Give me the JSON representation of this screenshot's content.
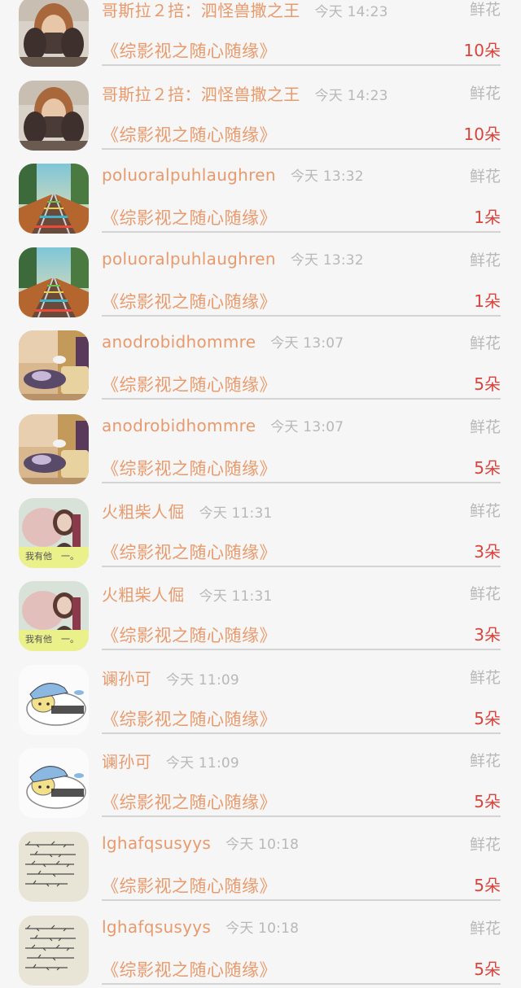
{
  "rows": [
    {
      "avatar": "avatar-woman-icon",
      "name": "哥斯拉２掊：泗怪兽撒之王",
      "time": "今天 14:23",
      "gift": "鲜花",
      "book": "《综影视之随心随缘》",
      "count": "10朵"
    },
    {
      "avatar": "avatar-woman-icon",
      "name": "哥斯拉２掊：泗怪兽撒之王",
      "time": "今天 14:23",
      "gift": "鲜花",
      "book": "《综影视之随心随缘》",
      "count": "10朵"
    },
    {
      "avatar": "avatar-railroad-icon",
      "name": "poluoralpuhlaughren",
      "time": "今天 13:32",
      "gift": "鲜花",
      "book": "《综影视之随心随缘》",
      "count": "1朵"
    },
    {
      "avatar": "avatar-railroad-icon",
      "name": "poluoralpuhlaughren",
      "time": "今天 13:32",
      "gift": "鲜花",
      "book": "《综影视之随心随缘》",
      "count": "1朵"
    },
    {
      "avatar": "avatar-room-icon",
      "name": "anodrobidhommre",
      "time": "今天 13:07",
      "gift": "鲜花",
      "book": "《综影视之随心随缘》",
      "count": "5朵"
    },
    {
      "avatar": "avatar-room-icon",
      "name": "anodrobidhommre",
      "time": "今天 13:07",
      "gift": "鲜花",
      "book": "《综影视之随心随缘》",
      "count": "5朵"
    },
    {
      "avatar": "avatar-girl-text-icon",
      "avatar_text": "我有他　一。",
      "name": "火粗柴人倔",
      "time": "今天 11:31",
      "gift": "鲜花",
      "book": "《综影视之随心随缘》",
      "count": "3朵"
    },
    {
      "avatar": "avatar-girl-text-icon",
      "avatar_text": "我有他　一。",
      "name": "火粗柴人倔",
      "time": "今天 11:31",
      "gift": "鲜花",
      "book": "《综影视之随心随缘》",
      "count": "3朵"
    },
    {
      "avatar": "avatar-cartoon-icon",
      "name": "谰孙可",
      "time": "今天 11:09",
      "gift": "鲜花",
      "book": "《综影视之随心随缘》",
      "count": "5朵"
    },
    {
      "avatar": "avatar-cartoon-icon",
      "name": "谰孙可",
      "time": "今天 11:09",
      "gift": "鲜花",
      "book": "《综影视之随心随缘》",
      "count": "5朵"
    },
    {
      "avatar": "avatar-handwriting-icon",
      "name": "lghafqsusyys",
      "time": "今天 10:18",
      "gift": "鲜花",
      "book": "《综影视之随心随缘》",
      "count": "5朵"
    },
    {
      "avatar": "avatar-handwriting-icon",
      "name": "lghafqsusyys",
      "time": "今天 10:18",
      "gift": "鲜花",
      "book": "《综影视之随心随缘》",
      "count": "5朵"
    }
  ],
  "colors": {
    "name": "#e89a6c",
    "book": "#e89a6c",
    "count": "#d8443c",
    "muted": "#b8b8b8",
    "background": "#f6f6f6"
  }
}
